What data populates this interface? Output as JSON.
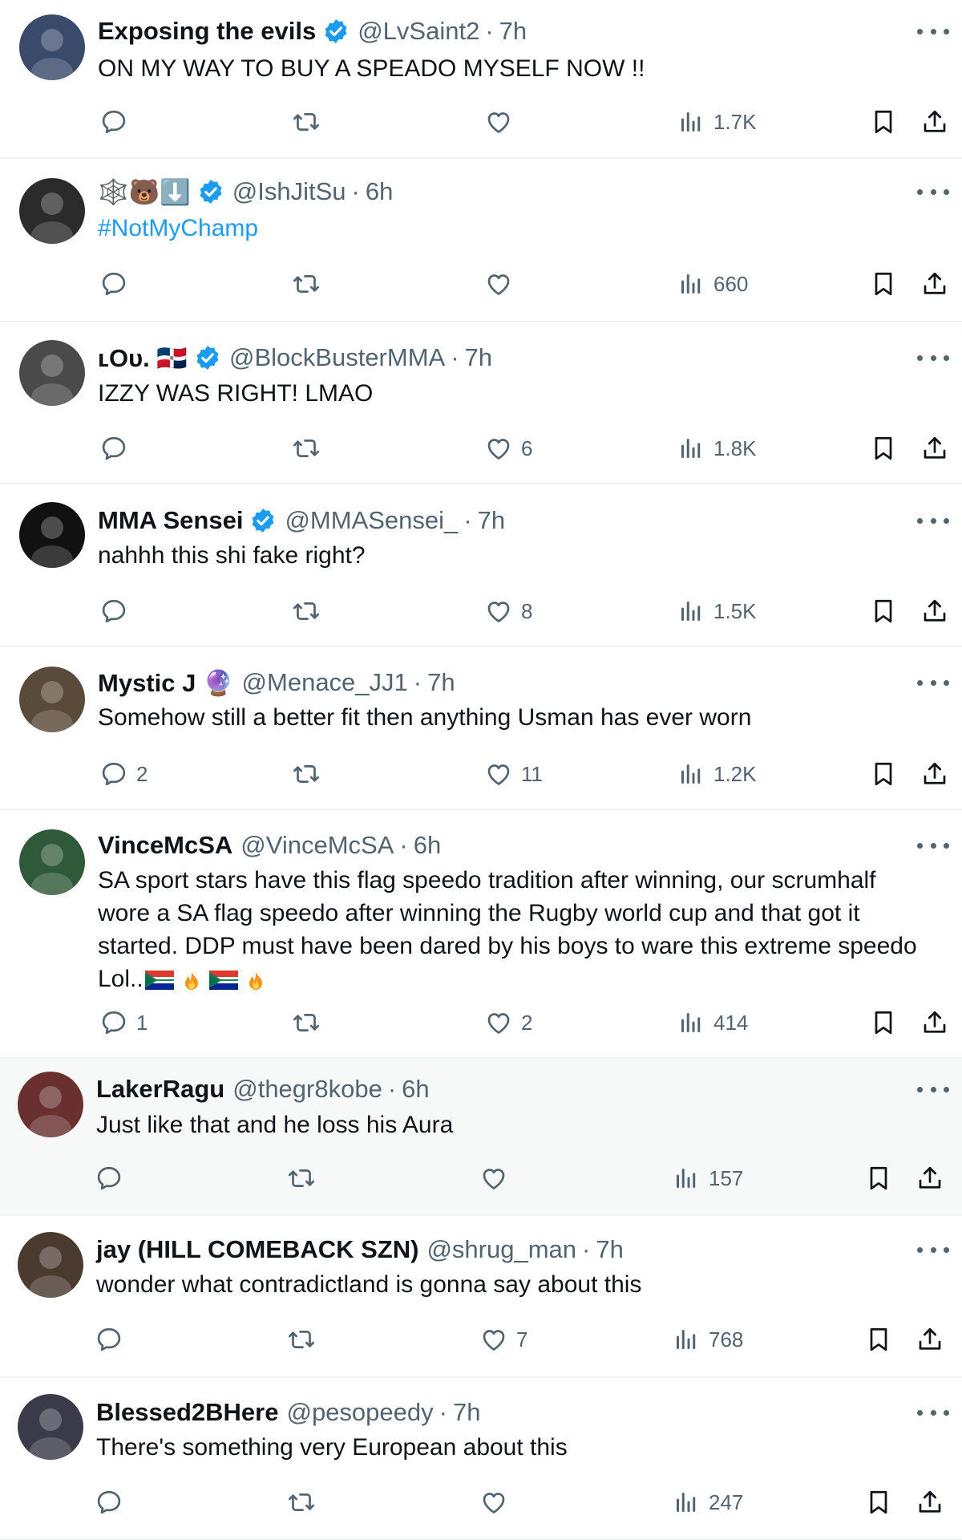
{
  "tweets": [
    {
      "name": "Exposing the evils",
      "verified": true,
      "handle": "@LvSaint2",
      "time": "7h",
      "text": "ON MY WAY TO BUY A SPEADO MYSELF NOW !!",
      "replies": "",
      "likes": "",
      "views": "1.7K",
      "avatar_color": "#3a4a6b"
    },
    {
      "name": "🕸️🐻⬇️",
      "verified": true,
      "handle": "@IshJitSu",
      "time": "6h",
      "text": "#NotMyChamp",
      "replies": "",
      "likes": "",
      "views": "660",
      "avatar_color": "#2b2b2b"
    },
    {
      "name": "ʟOᴜ. 🇩🇴",
      "verified": true,
      "handle": "@BlockBusterMMA",
      "time": "7h",
      "text": "IZZY WAS RIGHT! LMAO",
      "replies": "",
      "likes": "6",
      "views": "1.8K",
      "avatar_color": "#4a4a4a"
    },
    {
      "name": "MMA Sensei",
      "verified": true,
      "handle": "@MMASensei_",
      "time": "7h",
      "text": "nahhh this shi fake right?",
      "replies": "",
      "likes": "8",
      "views": "1.5K",
      "avatar_color": "#111111"
    },
    {
      "name": "Mystic J 🔮",
      "verified": false,
      "handle": "@Menace_JJ1",
      "time": "7h",
      "text": "Somehow still a better fit then anything Usman has ever worn",
      "replies": "2",
      "likes": "11",
      "views": "1.2K",
      "avatar_color": "#5a4a3a"
    },
    {
      "name": "VinceMcSA",
      "verified": false,
      "handle": "@VinceMcSA",
      "time": "6h",
      "text": "SA sport stars have this flag speedo tradition after winning, our scrumhalf wore a SA flag speedo after winning the Rugby world cup and that got it started. DDP must have been dared by his boys to ware this extreme speedo Lol..",
      "replies": "1",
      "likes": "2",
      "views": "414",
      "avatar_color": "#2f5a3a"
    },
    {
      "name": "LakerRagu",
      "verified": false,
      "handle": "@thegr8kobe",
      "time": "6h",
      "text": "Just like that and he loss his Aura",
      "replies": "",
      "likes": "",
      "views": "157",
      "avatar_color": "#6a3030"
    },
    {
      "name": "jay (HILL COMEBACK SZN)",
      "verified": false,
      "handle": "@shrug_man",
      "time": "7h",
      "text": "wonder what contradictland is gonna say about this",
      "replies": "",
      "likes": "7",
      "views": "768",
      "avatar_color": "#4a3a30"
    },
    {
      "name": "Blessed2BHere",
      "verified": false,
      "handle": "@pesopeedy",
      "time": "7h",
      "text": "There's something very European about this",
      "replies": "",
      "likes": "",
      "views": "247",
      "avatar_color": "#3a3a4a"
    }
  ],
  "colors": {
    "text": "#0f1419",
    "muted": "#536471",
    "link": "#1d9bf0",
    "verified": "#1d9bf0",
    "divider": "#eff3f4"
  },
  "icons": [
    "reply-icon",
    "retweet-icon",
    "like-icon",
    "views-icon",
    "bookmark-icon",
    "share-icon",
    "more-icon",
    "verified-icon"
  ]
}
